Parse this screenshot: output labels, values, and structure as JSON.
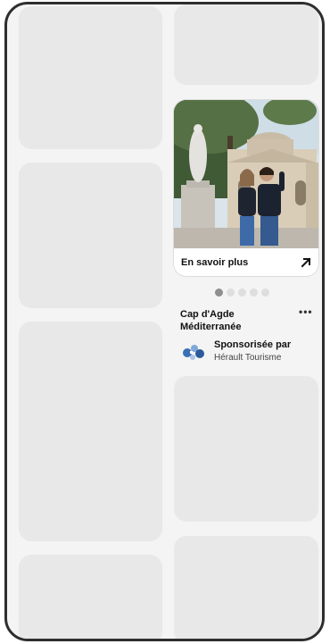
{
  "pin": {
    "cta_label": "En savoir plus",
    "title": "Cap d'Agde Méditerranée",
    "sponsored_label": "Sponsorisée par",
    "sponsor_name": "Hérault Tourisme",
    "image_icon": "arrow-up-right-icon",
    "more_icon": "more-options-icon",
    "carousel": {
      "count": 5,
      "active_index": 0
    }
  },
  "colors": {
    "placeholder": "#e8e8e8",
    "frame": "#2e2e2e",
    "text": "#111111",
    "dot_active": "#8f8f8f",
    "dot_inactive": "#dedede"
  }
}
